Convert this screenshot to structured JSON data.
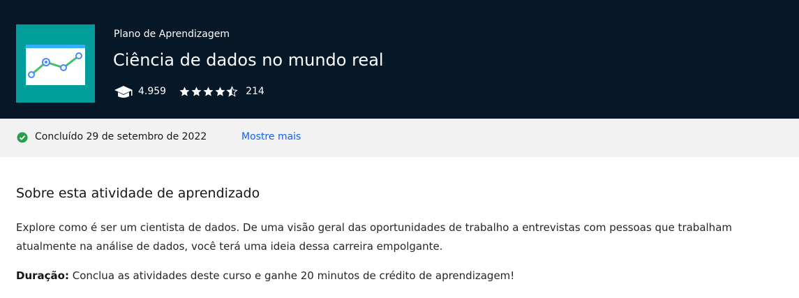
{
  "header": {
    "eyebrow": "Plano de Aprendizagem",
    "title": "Ciência de dados no mundo real",
    "learners": "4.959",
    "rating": 4.5,
    "reviews": "214",
    "thumbnail_icon": "line-chart-icon",
    "learners_icon": "graduation-cap-icon"
  },
  "status": {
    "completed_text": "Concluído 29 de setembro de 2022",
    "more_link": "Mostre mais",
    "check_icon": "check-circle-icon"
  },
  "about": {
    "heading": "Sobre esta atividade de aprendizado",
    "description": "Explore como é ser um cientista de dados. De uma visão geral das oportunidades de trabalho a entrevistas com pessoas que trabalham atualmente na análise de dados, você terá uma ideia dessa carreira empolgante.",
    "duration_label": "Duração:",
    "duration_text": " Conclua as atividades deste curso e ganhe 20 minutos de crédito de aprendizagem!"
  },
  "colors": {
    "hero_bg": "#061727",
    "thumb_bg": "#009d9a",
    "link": "#0f62fe",
    "success": "#24a148"
  }
}
